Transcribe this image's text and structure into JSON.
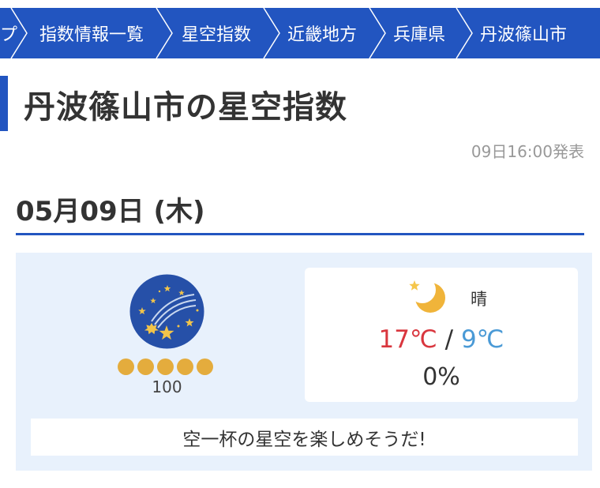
{
  "breadcrumb": {
    "items": [
      {
        "label": "プ"
      },
      {
        "label": "指数情報一覧"
      },
      {
        "label": "星空指数"
      },
      {
        "label": "近畿地方"
      },
      {
        "label": "兵庫県"
      },
      {
        "label": "丹波篠山市"
      }
    ]
  },
  "page": {
    "title": "丹波篠山市の星空指数",
    "issued": "09日16:00発表",
    "date": "05月09日 (木)"
  },
  "forecast": {
    "index_icon": "starry-sky-icon",
    "index_score": "100",
    "index_level": 5,
    "index_level_max": 5,
    "weather_icon": "moon-star-icon",
    "weather": "晴",
    "temp_high": "17℃",
    "temp_sep": "/",
    "temp_low": "9℃",
    "precip": "0%",
    "comment": "空一杯の星空を楽しめそうだ!"
  },
  "colors": {
    "accent": "#2255c0",
    "card_bg": "#e8f1fc",
    "star_dot": "#e4ac3d",
    "temp_high": "#d9363e",
    "temp_low": "#4a9ad6"
  }
}
